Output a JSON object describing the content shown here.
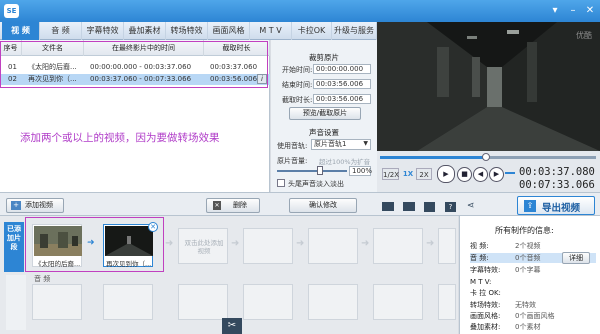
{
  "app": {
    "logo": "SE"
  },
  "tabs": [
    {
      "label": "视  频",
      "active": true
    },
    {
      "label": "音  频"
    },
    {
      "label": "字幕特效"
    },
    {
      "label": "叠加素材"
    },
    {
      "label": "转场特效"
    },
    {
      "label": "画面风格"
    },
    {
      "label": "M T V"
    },
    {
      "label": "卡拉OK"
    },
    {
      "label": "升级与服务"
    }
  ],
  "list": {
    "headers": [
      "序号",
      "文件名",
      "在最终影片中的时间",
      "截取时长"
    ],
    "rows": [
      {
        "num": "01",
        "name": "《太阳的后裔...",
        "time": "00:00:00.000 - 00:03:37.060",
        "dur": "00:03:37.060"
      },
      {
        "num": "02",
        "name": "再次见到你（...",
        "time": "00:03:37.060 - 00:07:33.066",
        "dur": "00:03:56.006",
        "selected": true
      }
    ],
    "hint": "添加两个或以上的视频，因为要做转场效果"
  },
  "clip": {
    "title": "裁剪原片",
    "start_label": "开始时间:",
    "start_value": "00:00:00.000",
    "end_label": "结束时间:",
    "end_value": "00:03:56.006",
    "dur_label": "截取时长:",
    "dur_value": "00:03:56.006",
    "preview_btn": "预览/截取原片",
    "sound_title": "声音设置",
    "track_label": "使用音轨:",
    "track_value": "原片音轨1",
    "vol_label": "原片音量:",
    "vol_hint": "超过100%为扩音",
    "vol_value": "100%",
    "fade_label": "头尾声音淡入淡出",
    "confirm_btn": "确认修改"
  },
  "player": {
    "watermark": "优酷",
    "speeds": [
      "1/2X",
      "1X",
      "2X"
    ],
    "time_current": "00:03:37.080",
    "time_total": "00:07:33.066",
    "progress_fraction": 0.48
  },
  "toolbar": {
    "add_video": "添加视频",
    "delete": "删除",
    "export": "导出视频"
  },
  "story": {
    "side_tag": "已添加片段",
    "clips": [
      {
        "caption": "《太阳的后裔..."
      },
      {
        "caption": "再次见到你（..."
      }
    ],
    "drop_hint": "双击此处添加视频",
    "audio_label": "音 频"
  },
  "info": {
    "title": "所有制作的信息:",
    "rows": [
      {
        "k": "视    频:",
        "v": "2个视频"
      },
      {
        "k": "音    频:",
        "v": "0个音频"
      },
      {
        "k": "字幕特效:",
        "v": "0个字幕"
      },
      {
        "k": "M  T  V:",
        "v": ""
      },
      {
        "k": "卡 拉 OK:",
        "v": ""
      },
      {
        "k": "转场特效:",
        "v": "无特效"
      },
      {
        "k": "画面风格:",
        "v": "0个画面风格"
      },
      {
        "k": "叠加素材:",
        "v": "0个素材"
      }
    ],
    "detail_btn": "详细"
  }
}
